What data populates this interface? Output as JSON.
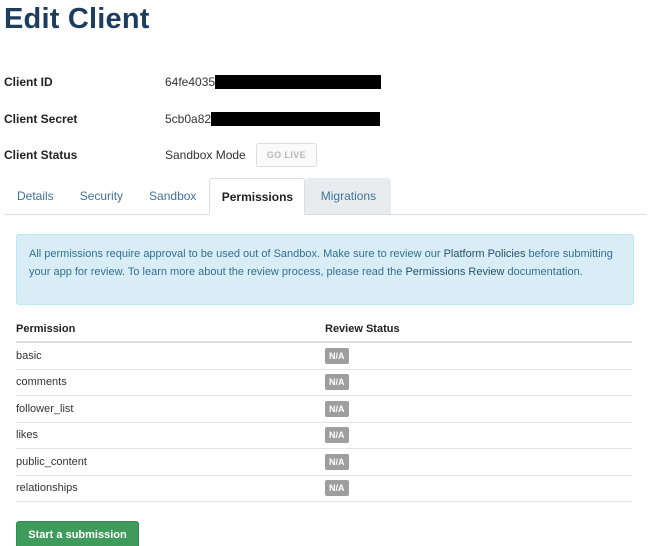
{
  "page": {
    "title": "Edit Client"
  },
  "client_info": {
    "client_id": {
      "label": "Client ID",
      "value_prefix": "64fe4035"
    },
    "client_secret": {
      "label": "Client Secret",
      "value_prefix": "5cb0a82"
    },
    "client_status": {
      "label": "Client Status",
      "value": "Sandbox Mode",
      "go_live_label": "GO LIVE"
    }
  },
  "tabs": [
    {
      "label": "Details"
    },
    {
      "label": "Security"
    },
    {
      "label": "Sandbox"
    },
    {
      "label": "Permissions"
    },
    {
      "label": "Migrations"
    }
  ],
  "alert": {
    "text_1": "All permissions require approval to be used out of Sandbox. Make sure to review our ",
    "link_1": "Platform Policies",
    "text_2": " before submitting your app for review. To learn more about the review process, please read the ",
    "link_2": "Permissions Review",
    "text_3": " documentation."
  },
  "permissions_table": {
    "headers": {
      "permission": "Permission",
      "status": "Review Status"
    },
    "rows": [
      {
        "permission": "basic",
        "status": "N/A"
      },
      {
        "permission": "comments",
        "status": "N/A"
      },
      {
        "permission": "follower_list",
        "status": "N/A"
      },
      {
        "permission": "likes",
        "status": "N/A"
      },
      {
        "permission": "public_content",
        "status": "N/A"
      },
      {
        "permission": "relationships",
        "status": "N/A"
      }
    ]
  },
  "actions": {
    "submit_label": "Start a submission"
  },
  "colors": {
    "title": "#1c3d5e",
    "link": "#3f729b",
    "alert_bg": "#d9edf7",
    "badge": "#9e9e9e",
    "submit": "#3e9b5b"
  }
}
